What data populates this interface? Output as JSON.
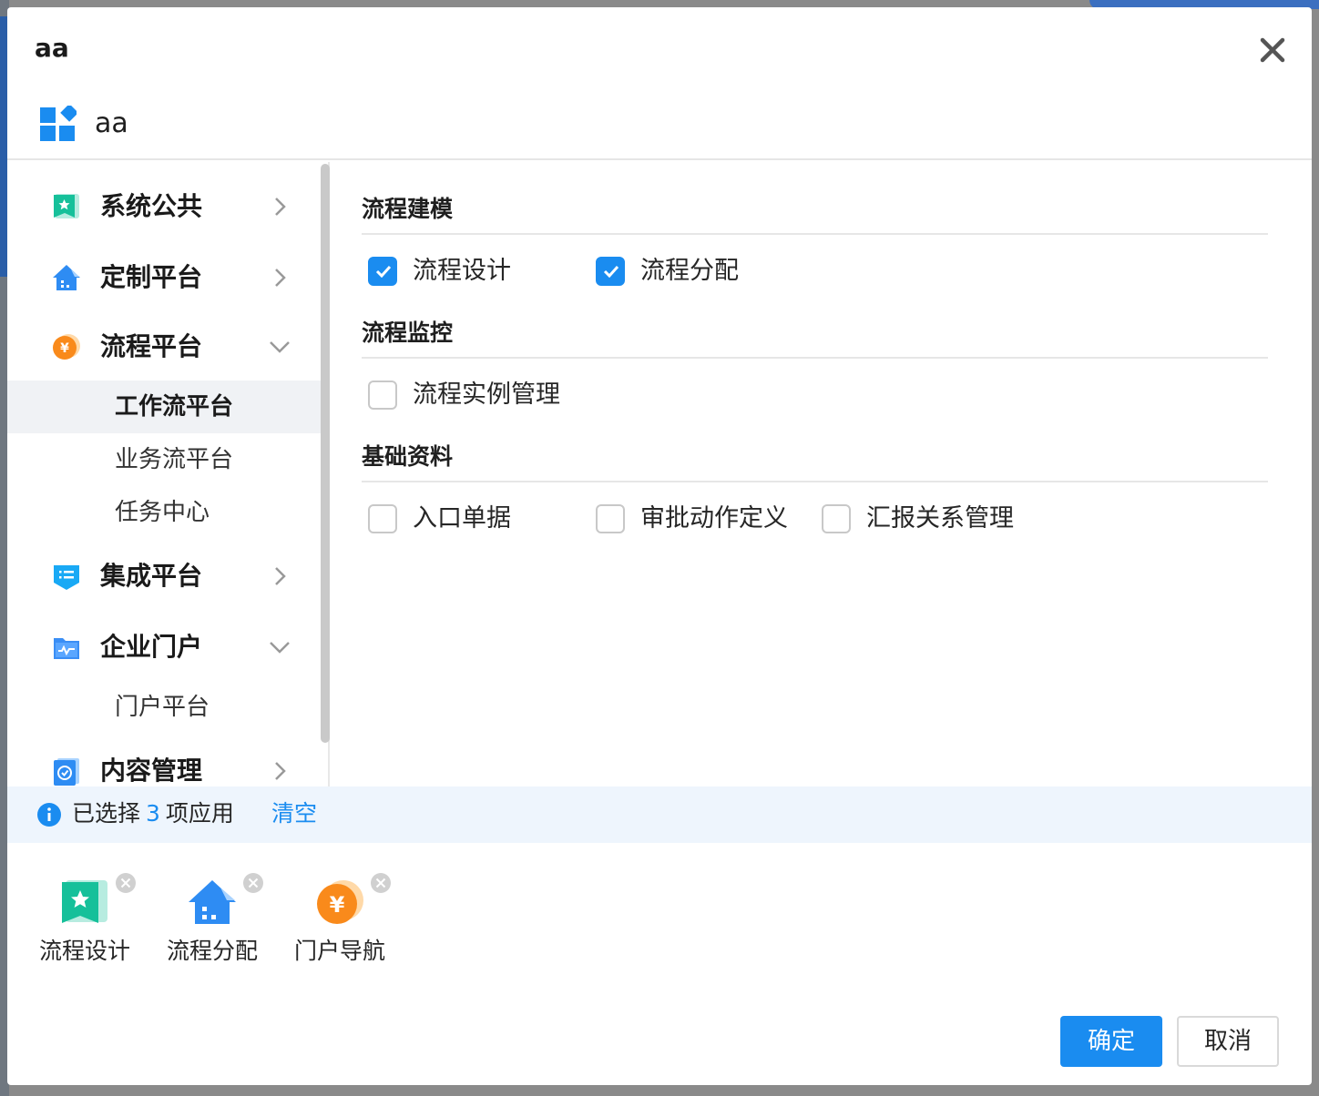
{
  "modal": {
    "title": "aa",
    "app_name": "aa"
  },
  "sidebar": {
    "items": [
      {
        "label": "系统公共",
        "icon": "green-star-icon",
        "expanded": false
      },
      {
        "label": "定制平台",
        "icon": "blue-house-icon",
        "expanded": false
      },
      {
        "label": "流程平台",
        "icon": "orange-yen-icon",
        "expanded": true,
        "children": [
          "工作流平台",
          "业务流平台",
          "任务中心"
        ],
        "active_child": "工作流平台"
      },
      {
        "label": "集成平台",
        "icon": "blue-list-icon",
        "expanded": false
      },
      {
        "label": "企业门户",
        "icon": "blue-chart-icon",
        "expanded": true,
        "children": [
          "门户平台"
        ]
      },
      {
        "label": "内容管理",
        "icon": "blue-clock-icon",
        "expanded": false
      }
    ]
  },
  "content": {
    "groups": [
      {
        "title": "流程建模",
        "options": [
          {
            "label": "流程设计",
            "checked": true
          },
          {
            "label": "流程分配",
            "checked": true
          }
        ]
      },
      {
        "title": "流程监控",
        "options": [
          {
            "label": "流程实例管理",
            "checked": false
          }
        ]
      },
      {
        "title": "基础资料",
        "options": [
          {
            "label": "入口单据",
            "checked": false
          },
          {
            "label": "审批动作定义",
            "checked": false
          },
          {
            "label": "汇报关系管理",
            "checked": false
          }
        ]
      }
    ]
  },
  "selection": {
    "prefix": "已选择",
    "count": "3",
    "suffix": "项应用",
    "clear_label": "清空",
    "chips": [
      {
        "label": "流程设计",
        "icon": "green-star-icon"
      },
      {
        "label": "流程分配",
        "icon": "blue-house-icon"
      },
      {
        "label": "门户导航",
        "icon": "orange-yen-icon"
      }
    ]
  },
  "footer": {
    "ok_label": "确定",
    "cancel_label": "取消"
  },
  "colors": {
    "primary": "#1a8cf0",
    "info_bg": "#eef5fd",
    "active_bg": "#f0f2f5"
  }
}
